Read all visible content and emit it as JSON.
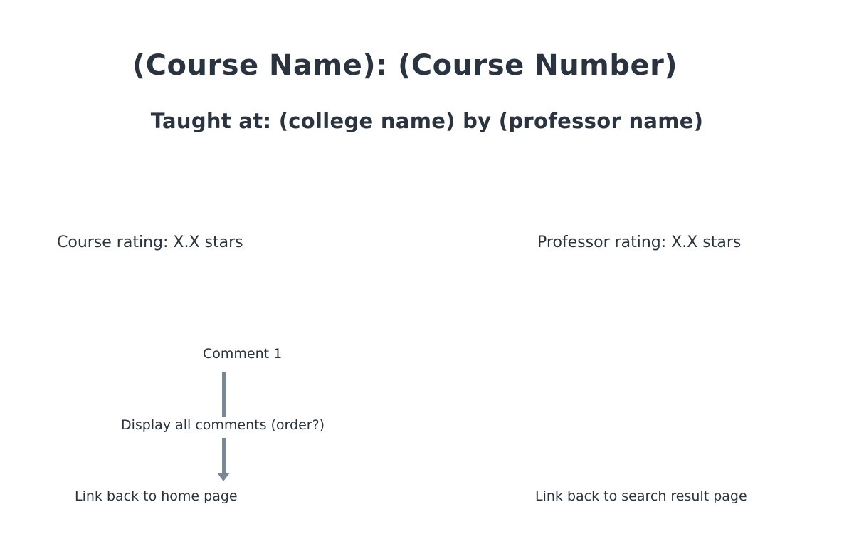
{
  "header": {
    "title": "(Course Name): (Course Number)",
    "subtitle": "Taught at: (college name) by (professor name)"
  },
  "ratings": {
    "course": "Course rating: X.X stars",
    "professor": "Professor rating: X.X stars"
  },
  "comments": {
    "first": "Comment 1",
    "display_all": "Display all comments (order?)"
  },
  "links": {
    "home": "Link back to home page",
    "search": "Link back to search result page"
  },
  "colors": {
    "text": "#2a3441",
    "connector": "#7a8795"
  }
}
